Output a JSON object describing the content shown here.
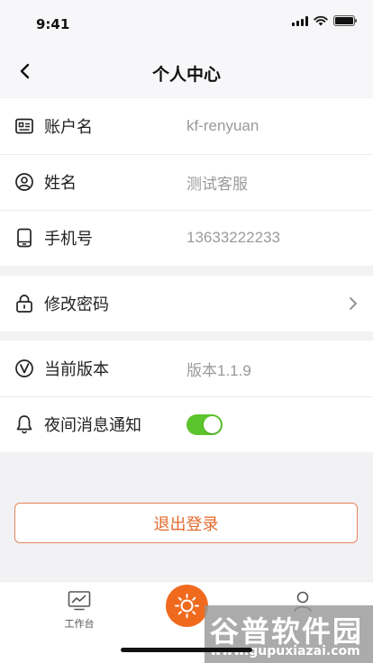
{
  "status_bar": {
    "time": "9:41"
  },
  "header": {
    "title": "个人中心"
  },
  "profile": {
    "account": {
      "label": "账户名",
      "value": "kf-renyuan"
    },
    "name": {
      "label": "姓名",
      "value": "测试客服"
    },
    "phone": {
      "label": "手机号",
      "value": "13633222233"
    }
  },
  "security": {
    "change_password_label": "修改密码"
  },
  "settings": {
    "version": {
      "label": "当前版本",
      "value": "版本1.1.9"
    },
    "night_notify": {
      "label": "夜间消息通知",
      "enabled": true
    }
  },
  "logout_label": "退出登录",
  "tabbar": {
    "workbench_label": "工作台"
  },
  "watermark": {
    "title": "谷普软件园",
    "url": "www.gupuxiazai.com"
  },
  "colors": {
    "accent": "#f06a1e",
    "toggle_on": "#5cc42d",
    "logout_border": "#e4845a"
  },
  "icons": [
    "back-arrow",
    "id-card",
    "user-circle",
    "phone",
    "lock",
    "version-v",
    "bell",
    "chevron-right",
    "monitor-chart",
    "sun",
    "person"
  ]
}
